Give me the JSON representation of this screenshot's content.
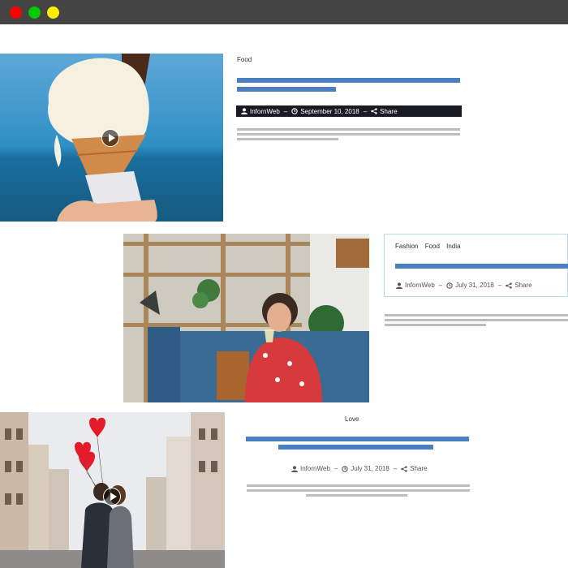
{
  "window": {
    "buttons": [
      "close",
      "minimize",
      "maximize"
    ]
  },
  "colors": {
    "title_line": "#4a7fc1",
    "text_line": "#bdbdbd",
    "meta_bar": "#1a1a24"
  },
  "posts": [
    {
      "categories": [
        "Food"
      ],
      "author": "InfornWeb",
      "date": "September 10, 2018",
      "share": "Share",
      "sep": "–",
      "media": "video"
    },
    {
      "categories": [
        "Fashion",
        "Food",
        "India"
      ],
      "author": "InfornWeb",
      "date": "July 31, 2018",
      "share": "Share",
      "sep": "–",
      "media": "image"
    },
    {
      "categories": [
        "Love"
      ],
      "author": "InfornWeb",
      "date": "July 31, 2018",
      "share": "Share",
      "sep": "–",
      "media": "video"
    }
  ]
}
